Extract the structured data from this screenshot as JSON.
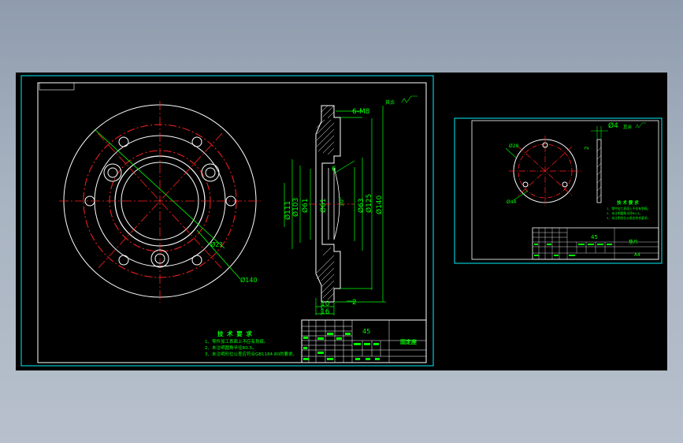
{
  "drawing_left": {
    "dims": {
      "d_bolt": "Ø21",
      "d_outer": "Ø140",
      "m8": "6-M8",
      "d111": "Ø111",
      "d103": "Ø103",
      "d61a": "Ø61",
      "d61b": "Ø61",
      "d63": "Ø63",
      "d125": "Ø125",
      "d140": "Ø140",
      "dim6": "6",
      "angle": "30°",
      "dim10": "10",
      "dim2": "2",
      "dim16": "16",
      "roughness": "其余"
    },
    "notes": {
      "title": "技 术 要 求",
      "items": [
        "1、零件加工表面上不应有划痕。",
        "2、未注明圆角半径R0.5。",
        "3、未注明形位公差应符合GB1184-80的要求。"
      ]
    },
    "titleblock": {
      "material": "45",
      "name": "固定座"
    }
  },
  "drawing_right": {
    "dims": {
      "d_small": "Ø4",
      "d28": "Ø28",
      "d44": "Ø44",
      "d2": "2",
      "roughness": "其余"
    },
    "notes": {
      "title": "技 术 要 求",
      "items": [
        "1、零件加工表面上不应有划痕。",
        "2、未注明圆角半径R0.5。",
        "3、未注明形位公差应符合要求。"
      ]
    },
    "titleblock": {
      "material": "45",
      "name": "垫片",
      "scale": "A4"
    }
  }
}
